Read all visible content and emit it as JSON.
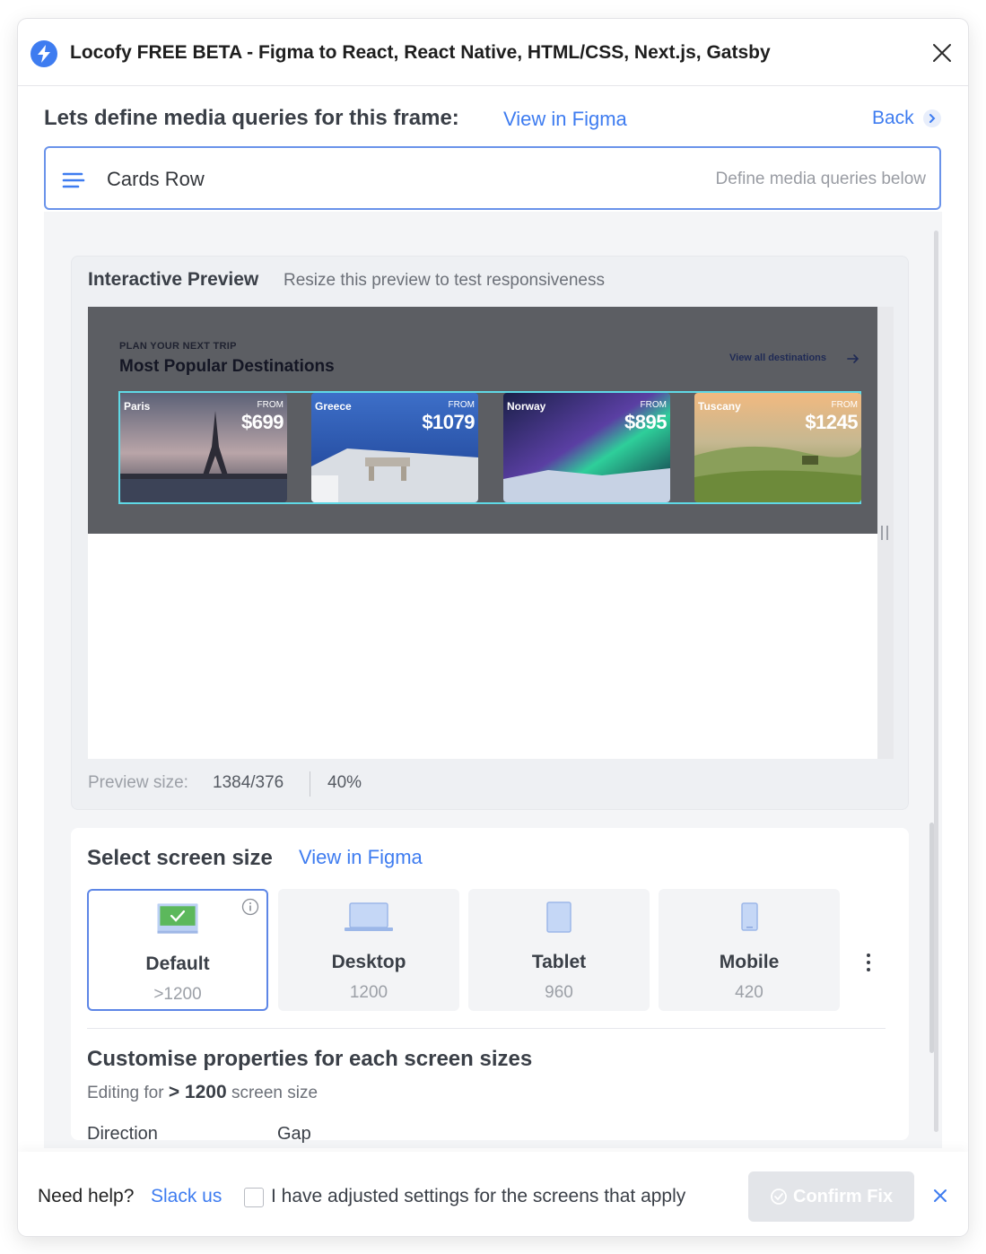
{
  "window": {
    "title": "Locofy FREE BETA - Figma to React, React Native, HTML/CSS, Next.js, Gatsby"
  },
  "header": {
    "title": "Lets define media queries for this frame:",
    "view_link": "View in Figma",
    "back_label": "Back"
  },
  "frame": {
    "name": "Cards Row",
    "hint": "Define media queries below"
  },
  "preview": {
    "heading": "Interactive Preview",
    "subtitle": "Resize this preview to test responsiveness",
    "content": {
      "eyebrow": "PLAN YOUR NEXT TRIP",
      "title": "Most Popular Destinations",
      "view_all": "View all destinations",
      "cards": [
        {
          "name": "Paris",
          "from": "FROM",
          "price": "$699"
        },
        {
          "name": "Greece",
          "from": "FROM",
          "price": "$1079"
        },
        {
          "name": "Norway",
          "from": "FROM",
          "price": "$895"
        },
        {
          "name": "Tuscany",
          "from": "FROM",
          "price": "$1245"
        }
      ]
    },
    "size_label": "Preview size:",
    "size_value": "1384/376",
    "zoom": "40%"
  },
  "screens": {
    "title": "Select screen size",
    "view_link": "View in Figma",
    "tiles": [
      {
        "label": "Default",
        "value": ">1200",
        "icon": "monitor-check-icon",
        "active": true
      },
      {
        "label": "Desktop",
        "value": "1200",
        "icon": "laptop-icon",
        "active": false
      },
      {
        "label": "Tablet",
        "value": "960",
        "icon": "tablet-icon",
        "active": false
      },
      {
        "label": "Mobile",
        "value": "420",
        "icon": "mobile-icon",
        "active": false
      }
    ],
    "customise_title": "Customise properties for each screen sizes",
    "editing_prefix": "Editing for",
    "editing_value": "> 1200",
    "editing_suffix": "screen size",
    "properties": [
      "Direction",
      "Gap"
    ]
  },
  "footer": {
    "help_text": "Need help?",
    "slack_link": "Slack us",
    "checkbox_label": "I have adjusted settings for the screens that apply",
    "confirm_label": "Confirm Fix"
  },
  "colors": {
    "accent": "#3e7cf0",
    "check_green": "#5cb85c",
    "cards_outline": "#5fd9e6"
  }
}
